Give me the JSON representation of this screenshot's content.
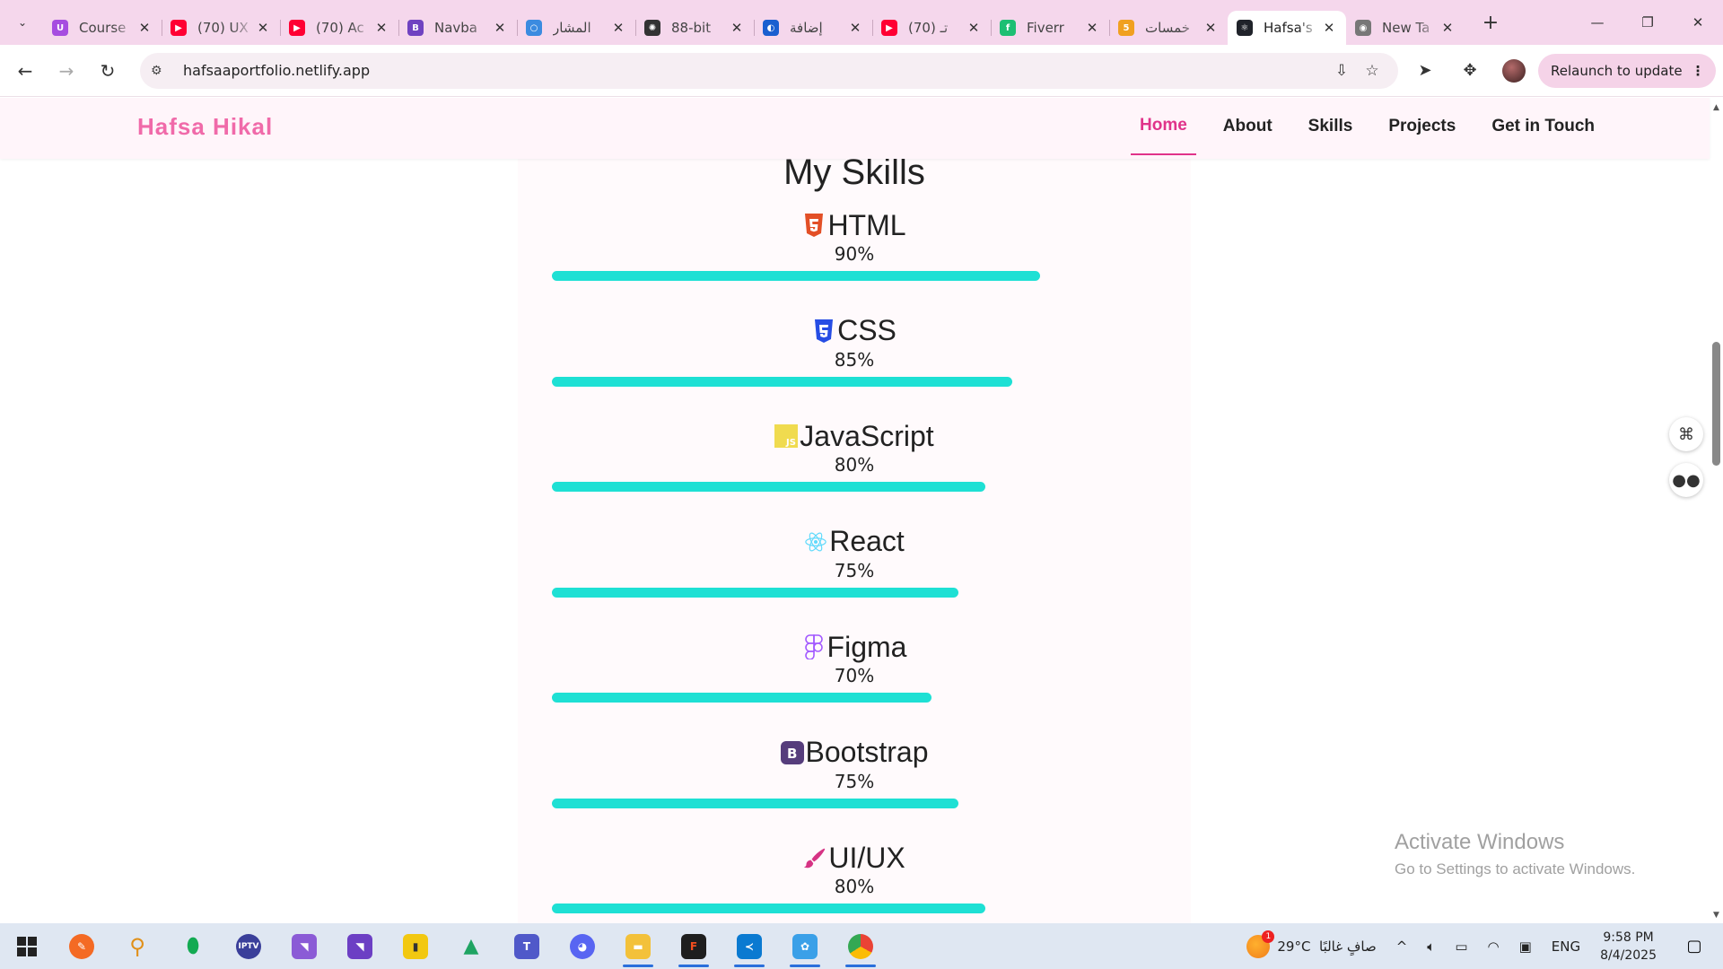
{
  "browser": {
    "tabs": [
      {
        "title": "Course",
        "favicon_color": "#a64de0",
        "favicon_glyph": "U"
      },
      {
        "title": "(70) UX",
        "favicon_color": "#ff0033",
        "favicon_glyph": "▶"
      },
      {
        "title": "(70) Ac",
        "favicon_color": "#ff0033",
        "favicon_glyph": "▶"
      },
      {
        "title": "Navba",
        "favicon_color": "#6f42c1",
        "favicon_glyph": "B"
      },
      {
        "title": "المشار",
        "favicon_color": "#3b8be0",
        "favicon_glyph": "○"
      },
      {
        "title": "88-bit",
        "favicon_color": "#333333",
        "favicon_glyph": "✺"
      },
      {
        "title": "إضافة",
        "favicon_color": "#1a5fd0",
        "favicon_glyph": "◐"
      },
      {
        "title": "(70) تـ",
        "favicon_color": "#ff0033",
        "favicon_glyph": "▶"
      },
      {
        "title": "Fiverr",
        "favicon_color": "#1dbf73",
        "favicon_glyph": "f"
      },
      {
        "title": "خمسات",
        "favicon_color": "#f0a020",
        "favicon_glyph": "5"
      },
      {
        "title": "Hafsa's",
        "favicon_color": "#20232a",
        "favicon_glyph": "⚛",
        "active": true
      },
      {
        "title": "New Ta",
        "favicon_color": "#777777",
        "favicon_glyph": "◉"
      }
    ],
    "url": "hafsaaportfolio.netlify.app",
    "relaunch_label": "Relaunch to update"
  },
  "site": {
    "brand": "Hafsa Hikal",
    "brand_color": "#f06aa9",
    "accent_color": "#e0338a",
    "menu": [
      {
        "label": "Home",
        "active": true
      },
      {
        "label": "About"
      },
      {
        "label": "Skills"
      },
      {
        "label": "Projects"
      },
      {
        "label": "Get in Touch"
      }
    ],
    "section_title": "My Skills",
    "bar_color": "#1ee0d4",
    "skills": [
      {
        "name": "HTML",
        "percent_label": "90%",
        "value": 90,
        "icon": "html5-icon"
      },
      {
        "name": "CSS",
        "percent_label": "85%",
        "value": 85,
        "icon": "css3-icon"
      },
      {
        "name": "JavaScript",
        "percent_label": "80%",
        "value": 80,
        "icon": "javascript-icon"
      },
      {
        "name": "React",
        "percent_label": "75%",
        "value": 75,
        "icon": "react-icon"
      },
      {
        "name": "Figma",
        "percent_label": "70%",
        "value": 70,
        "icon": "figma-icon"
      },
      {
        "name": "Bootstrap",
        "percent_label": "75%",
        "value": 75,
        "icon": "bootstrap-icon"
      },
      {
        "name": "UI/UX",
        "percent_label": "80%",
        "value": 80,
        "icon": "brush-icon"
      }
    ]
  },
  "overlay": {
    "activate_title": "Activate Windows",
    "activate_sub": "Go to Settings to activate Windows."
  },
  "taskbar": {
    "weather": "29°C",
    "weather_desc": "صافٍ غالبًا",
    "weather_badge": "1",
    "language": "ENG",
    "time": "9:58 PM",
    "date": "8/4/2025"
  }
}
